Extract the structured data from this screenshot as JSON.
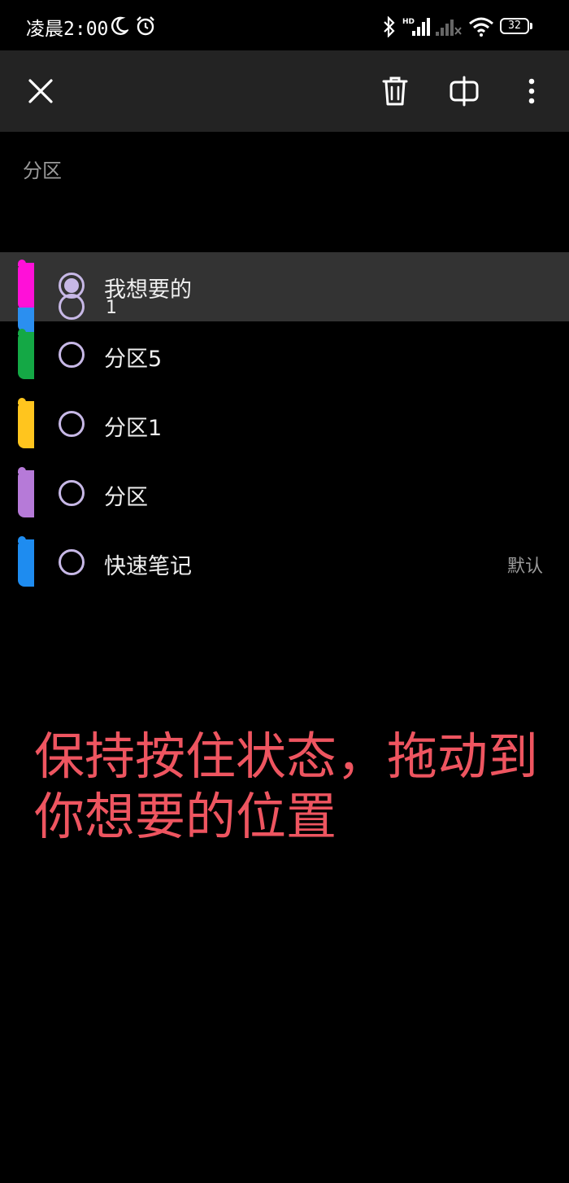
{
  "status_bar": {
    "time": "凌晨2:00",
    "battery": "32",
    "icons": [
      "moon-icon",
      "alarm-icon",
      "bluetooth-icon",
      "signal-hd-icon",
      "signal-empty-icon",
      "wifi-icon",
      "battery-icon"
    ]
  },
  "toolbar": {
    "close_icon": "close-icon",
    "delete_icon": "trash-icon",
    "split_icon": "split-view-icon",
    "more_icon": "more-vert-icon"
  },
  "page": {
    "section_title": "分区"
  },
  "sections": [
    {
      "label": "我想要的",
      "color": "#ff10d8",
      "color2": "#2b8ff0",
      "checked": true,
      "ghost_label": "1"
    },
    {
      "label": "分区5",
      "color": "#14a845",
      "checked": false
    },
    {
      "label": "分区1",
      "color": "#ffc51e",
      "checked": false
    },
    {
      "label": "分区",
      "color": "#b67ad8",
      "checked": false
    },
    {
      "label": "快速笔记",
      "color": "#1e8cf0",
      "checked": false,
      "badge": "默认"
    }
  ],
  "instruction": {
    "text": "保持按住状态，拖动到你想要的位置"
  }
}
